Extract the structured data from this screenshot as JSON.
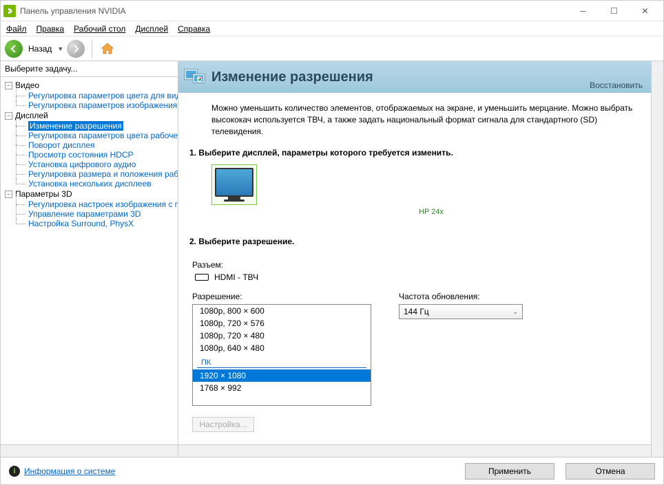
{
  "window": {
    "title": "Панель управления NVIDIA"
  },
  "menu": {
    "file": "Файл",
    "edit": "Правка",
    "desktop": "Рабочий стол",
    "display": "Дисплей",
    "help": "Справка"
  },
  "toolbar": {
    "back": "Назад"
  },
  "sidebar": {
    "header": "Выберите задачу...",
    "cat_video": "Видео",
    "video_items": [
      "Регулировка параметров цвета для вид",
      "Регулировка параметров изображения д"
    ],
    "cat_display": "Дисплей",
    "display_items": [
      "Изменение разрешения",
      "Регулировка параметров цвета рабочег",
      "Поворот дисплея",
      "Просмотр состояния HDCP",
      "Установка цифрового аудио",
      "Регулировка размера и положения рабо",
      "Установка нескольких дисплеев"
    ],
    "cat_3d": "Параметры 3D",
    "d3_items": [
      "Регулировка настроек изображения с пр",
      "Управление параметрами 3D",
      "Настройка Surround, PhysX"
    ]
  },
  "page": {
    "title": "Изменение разрешения",
    "restore": "Восстановить",
    "description": "Можно уменьшить количество элементов, отображаемых на экране, и уменьшить мерцание. Можно выбрать высококач используется ТВЧ, а также задать национальный формат сигнала для стандартного (SD) телевидения.",
    "step1": "1. Выберите дисплей, параметры которого требуется изменить.",
    "monitor": "HP 24x",
    "step2": "2. Выберите разрешение.",
    "connector_label": "Разъем:",
    "connector_value": "HDMI - ТВЧ",
    "resolution_label": "Разрешение:",
    "refresh_label": "Частота обновления:",
    "refresh_value": "144 Гц",
    "resolutions_hd": [
      "1080p, 800 × 600",
      "1080p, 720 × 576",
      "1080p, 720 × 480",
      "1080p, 640 × 480"
    ],
    "pc_group": "ПК",
    "resolutions_pc": [
      "1920 × 1080",
      "1768 × 992"
    ],
    "selected_resolution": "1920 × 1080",
    "setup_btn": "Настройка..."
  },
  "footer": {
    "sysinfo": "Информация о системе",
    "apply": "Применить",
    "cancel": "Отмена"
  }
}
